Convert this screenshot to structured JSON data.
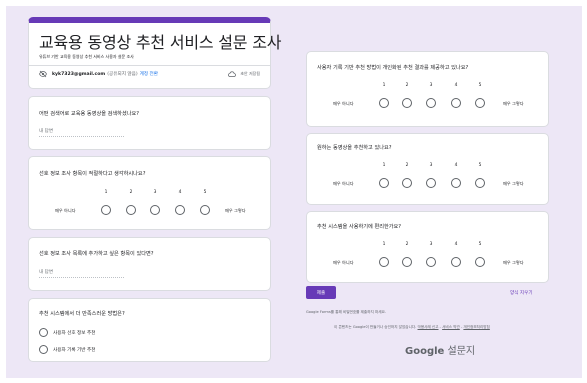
{
  "form": {
    "title": "교육용 동영상 추천 서비스 설문 조사",
    "description": "유튜브 기반 교육용 동영상 추천 서비스 사용자 설문 조사",
    "email": "kyk7323@gmail.com",
    "email_note": "(공유되지 않음)",
    "switch_account": "계정 전환",
    "draft_saved": "초안 저장됨"
  },
  "scale": {
    "numbers": [
      "1",
      "2",
      "3",
      "4",
      "5"
    ],
    "low": "매우 아니다",
    "high": "매우 그렇다"
  },
  "questions": {
    "q1": {
      "text": "어떤 검색어로 교육용 동영상을 검색하셨나요?",
      "placeholder": "내 답변"
    },
    "q2": {
      "text": "선호 정보 조사 항목이 적절하다고 생각하시나요?"
    },
    "q3": {
      "text": "선호 정보 조사 목록에 추가하고 싶은 항목이 있다면?",
      "placeholder": "내 답변"
    },
    "q4": {
      "text": "추천 시스템에서 더 만족스러운 방법은?",
      "options": [
        "사용자 선호 정보 추천",
        "사용자 기록 기반 추천"
      ]
    },
    "q5": {
      "text": "사용자 기록 기반 추천 방법이 개인화된 추천 결과를 제공하고 있나요?"
    },
    "q6": {
      "text": "원하는 동영상을 추천하고 있나요?"
    },
    "q7": {
      "text": "추천 시스템을 사용하기에 편리한가요?"
    }
  },
  "footer": {
    "submit": "제출",
    "clear": "양식 지우기",
    "warning": "Google Forms를 통해 비밀번호를 제출하지 마세요.",
    "disclaimer": "이 콘텐츠는 Google이 만들거나 승인하지 않았습니다.",
    "report_link": "악용사례 신고",
    "terms_link": "서비스 약관",
    "privacy_link": "개인정보처리방침",
    "brand_google": "Google",
    "brand_forms": "설문지"
  },
  "colors": {
    "accent": "#673ab7",
    "background": "#ede7f6",
    "link": "#1a73e8"
  }
}
